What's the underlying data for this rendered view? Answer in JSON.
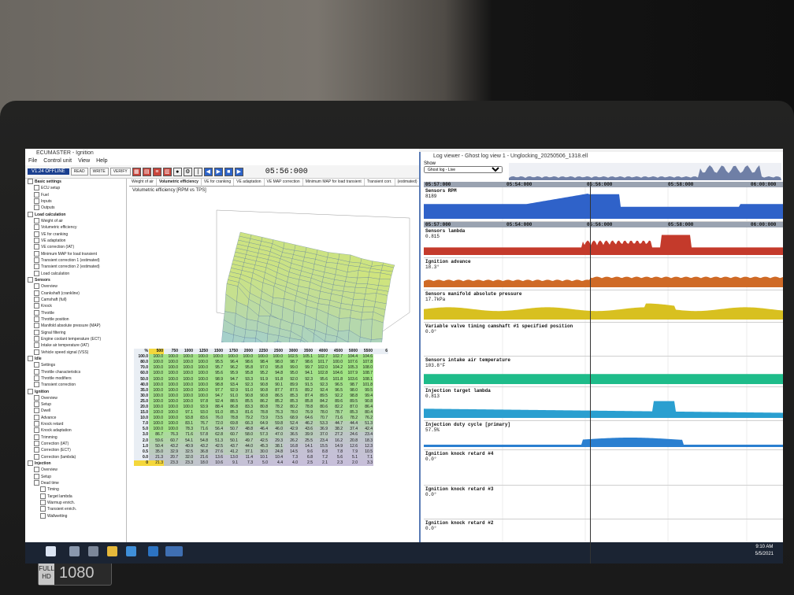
{
  "main_window": {
    "title": "ECUMASTER - Ignition",
    "menu": [
      "File",
      "Control unit",
      "View",
      "Help"
    ],
    "status": "V1.24 OFFLINE",
    "buttons": [
      "READ",
      "WRITE",
      "VERIFY"
    ],
    "time": "05:56:000"
  },
  "tree": [
    {
      "level": 0,
      "label": "Basic settings"
    },
    {
      "level": 1,
      "label": "ECU setup"
    },
    {
      "level": 1,
      "label": "Fuel"
    },
    {
      "level": 1,
      "label": "Inputs"
    },
    {
      "level": 1,
      "label": "Outputs"
    },
    {
      "level": 0,
      "label": "Load calculation"
    },
    {
      "level": 1,
      "label": "Weight of air"
    },
    {
      "level": 1,
      "label": "Volumetric efficiency"
    },
    {
      "level": 1,
      "label": "VE for cranking"
    },
    {
      "level": 1,
      "label": "VE adaptation"
    },
    {
      "level": 1,
      "label": "VE correction (IAT)"
    },
    {
      "level": 1,
      "label": "Minimum MAP for load transient"
    },
    {
      "level": 1,
      "label": "Transient correction 1 (estimated)"
    },
    {
      "level": 1,
      "label": "Transient correction 2 (estimated)"
    },
    {
      "level": 1,
      "label": "Load calculation"
    },
    {
      "level": 0,
      "label": "Sensors"
    },
    {
      "level": 1,
      "label": "Overview"
    },
    {
      "level": 1,
      "label": "Crankshaft (crankline)"
    },
    {
      "level": 1,
      "label": "Camshaft (full)"
    },
    {
      "level": 1,
      "label": "Knock"
    },
    {
      "level": 1,
      "label": "Throttle"
    },
    {
      "level": 1,
      "label": "Throttle position"
    },
    {
      "level": 1,
      "label": "Manifold absolute pressure (MAP)"
    },
    {
      "level": 1,
      "label": "Signal filtering"
    },
    {
      "level": 1,
      "label": "Engine coolant temperature (ECT)"
    },
    {
      "level": 1,
      "label": "Intake air temperature (IAT)"
    },
    {
      "level": 1,
      "label": "Vehicle speed signal (VSS)"
    },
    {
      "level": 0,
      "label": "Idle"
    },
    {
      "level": 1,
      "label": "Settings"
    },
    {
      "level": 1,
      "label": "Throttle characteristics"
    },
    {
      "level": 1,
      "label": "Throttle modifiers"
    },
    {
      "level": 1,
      "label": "Transient correction"
    },
    {
      "level": 0,
      "label": "Ignition"
    },
    {
      "level": 1,
      "label": "Overview"
    },
    {
      "level": 1,
      "label": "Setup"
    },
    {
      "level": 1,
      "label": "Dwell"
    },
    {
      "level": 1,
      "label": "Advance"
    },
    {
      "level": 1,
      "label": "Knock retard"
    },
    {
      "level": 1,
      "label": "Knock adaptation"
    },
    {
      "level": 1,
      "label": "Trimming"
    },
    {
      "level": 1,
      "label": "Correction (IAT)"
    },
    {
      "level": 1,
      "label": "Correction (ECT)"
    },
    {
      "level": 1,
      "label": "Correction (lambda)"
    },
    {
      "level": 0,
      "label": "Injection"
    },
    {
      "level": 1,
      "label": "Overview"
    },
    {
      "level": 1,
      "label": "Setup"
    },
    {
      "level": 1,
      "label": "Dead time"
    },
    {
      "level": 2,
      "label": "Timing"
    },
    {
      "level": 2,
      "label": "Target lambda"
    },
    {
      "level": 2,
      "label": "Warmup enrich."
    },
    {
      "level": 2,
      "label": "Transient enrich."
    },
    {
      "level": 2,
      "label": "Wallwetting"
    }
  ],
  "tabs": [
    "Weight of air",
    "Volumetric efficiency",
    "VE for cranking",
    "VE adaptation",
    "VE MAP correction",
    "Minimum MAP for load transient",
    "Transient corr.",
    "(estimated)"
  ],
  "table_title": "Volumetric efficiency [RPM vs TPS]",
  "grid": {
    "corner": "%",
    "rpm": [
      "500",
      "750",
      "1000",
      "1250",
      "1500",
      "1750",
      "2000",
      "2250",
      "2500",
      "3000",
      "3500",
      "4000",
      "4500",
      "5000",
      "5500",
      "6"
    ],
    "rows": [
      {
        "tps": "100.0",
        "v": [
          "100.0",
          "100.0",
          "100.0",
          "100.0",
          "100.0",
          "100.0",
          "100.0",
          "100.0",
          "100.0",
          "102.5",
          "105.1",
          "102.7",
          "102.7",
          "104.4",
          "104.6"
        ]
      },
      {
        "tps": "80.0",
        "v": [
          "100.0",
          "100.0",
          "100.0",
          "100.0",
          "95.5",
          "96.4",
          "98.6",
          "98.4",
          "98.0",
          "98.7",
          "98.6",
          "101.7",
          "100.0",
          "107.6",
          "107.8"
        ]
      },
      {
        "tps": "70.0",
        "v": [
          "100.0",
          "100.0",
          "100.0",
          "100.0",
          "95.7",
          "96.2",
          "95.8",
          "97.0",
          "95.8",
          "99.0",
          "99.7",
          "102.0",
          "104.2",
          "105.3",
          "108.0"
        ]
      },
      {
        "tps": "60.0",
        "v": [
          "100.0",
          "100.0",
          "100.0",
          "100.0",
          "95.6",
          "95.9",
          "95.8",
          "95.2",
          "94.8",
          "95.0",
          "94.1",
          "102.8",
          "104.6",
          "107.9",
          "108.7"
        ]
      },
      {
        "tps": "50.0",
        "v": [
          "100.0",
          "100.0",
          "100.0",
          "100.0",
          "98.9",
          "94.7",
          "93.3",
          "91.9",
          "91.8",
          "92.0",
          "92.3",
          "95.6",
          "101.8",
          "103.6",
          "108.1"
        ]
      },
      {
        "tps": "40.0",
        "v": [
          "100.0",
          "100.0",
          "100.0",
          "100.0",
          "98.8",
          "93.4",
          "92.3",
          "90.8",
          "90.1",
          "89.9",
          "91.5",
          "92.3",
          "96.5",
          "98.7",
          "101.8"
        ]
      },
      {
        "tps": "35.0",
        "v": [
          "100.0",
          "100.0",
          "100.0",
          "100.0",
          "97.7",
          "92.9",
          "91.0",
          "90.8",
          "87.7",
          "87.5",
          "89.2",
          "92.4",
          "96.5",
          "98.0",
          "99.5"
        ]
      },
      {
        "tps": "30.0",
        "v": [
          "100.0",
          "100.0",
          "100.0",
          "100.0",
          "94.7",
          "91.0",
          "90.8",
          "90.8",
          "86.5",
          "85.3",
          "87.4",
          "89.5",
          "92.2",
          "98.8",
          "99.4"
        ]
      },
      {
        "tps": "25.0",
        "v": [
          "100.0",
          "100.0",
          "100.0",
          "97.8",
          "92.4",
          "88.5",
          "85.5",
          "86.2",
          "85.2",
          "85.3",
          "85.8",
          "84.2",
          "89.6",
          "89.5",
          "90.8"
        ]
      },
      {
        "tps": "20.0",
        "v": [
          "100.0",
          "100.0",
          "100.0",
          "93.9",
          "88.4",
          "86.8",
          "83.3",
          "80.8",
          "78.2",
          "80.2",
          "78.8",
          "80.6",
          "82.2",
          "87.0",
          "86.4"
        ]
      },
      {
        "tps": "15.0",
        "v": [
          "100.0",
          "100.0",
          "97.1",
          "93.0",
          "91.0",
          "85.3",
          "81.6",
          "78.8",
          "76.3",
          "78.0",
          "76.9",
          "78.0",
          "78.7",
          "85.3",
          "80.4"
        ]
      },
      {
        "tps": "10.0",
        "v": [
          "100.0",
          "100.0",
          "93.8",
          "83.6",
          "76.0",
          "78.8",
          "79.2",
          "73.9",
          "73.5",
          "68.9",
          "64.6",
          "70.7",
          "71.6",
          "78.2",
          "76.2"
        ]
      },
      {
        "tps": "7.0",
        "v": [
          "100.0",
          "100.0",
          "83.1",
          "76.7",
          "72.0",
          "69.8",
          "66.3",
          "64.9",
          "59.8",
          "52.4",
          "46.2",
          "53.3",
          "44.7",
          "44.4",
          "51.3"
        ]
      },
      {
        "tps": "5.0",
        "v": [
          "100.0",
          "100.0",
          "78.3",
          "71.6",
          "56.4",
          "50.7",
          "48.8",
          "46.4",
          "46.0",
          "42.9",
          "43.6",
          "36.9",
          "38.2",
          "37.4",
          "42.4"
        ]
      },
      {
        "tps": "3.0",
        "v": [
          "86.7",
          "76.3",
          "71.6",
          "57.8",
          "62.8",
          "60.7",
          "58.0",
          "57.3",
          "47.0",
          "36.5",
          "39.9",
          "37.0",
          "27.2",
          "24.6",
          "23.4"
        ]
      },
      {
        "tps": "2.0",
        "v": [
          "59.6",
          "60.7",
          "54.1",
          "54.8",
          "51.3",
          "50.1",
          "49.7",
          "42.5",
          "29.3",
          "26.2",
          "25.5",
          "23.4",
          "16.2",
          "20.8",
          "18.3"
        ]
      },
      {
        "tps": "1.0",
        "v": [
          "50.4",
          "43.2",
          "40.9",
          "43.2",
          "42.5",
          "43.7",
          "44.0",
          "45.3",
          "38.1",
          "16.8",
          "14.1",
          "15.5",
          "14.9",
          "12.6",
          "12.3"
        ]
      },
      {
        "tps": "0.5",
        "v": [
          "35.0",
          "32.9",
          "32.5",
          "36.8",
          "27.6",
          "41.2",
          "37.1",
          "30.0",
          "24.8",
          "14.5",
          "9.6",
          "8.8",
          "7.8",
          "7.9",
          "10.5"
        ]
      },
      {
        "tps": "0.0",
        "v": [
          "21.3",
          "20.7",
          "32.0",
          "21.6",
          "13.6",
          "13.0",
          "11.4",
          "10.1",
          "10.4",
          "7.3",
          "6.8",
          "7.2",
          "5.6",
          "5.1",
          "7.1"
        ]
      },
      {
        "tps": "0",
        "v": [
          "21.3",
          "23.3",
          "23.3",
          "18.0",
          "10.6",
          "9.1",
          "7.3",
          "5.0",
          "4.4",
          "4.0",
          "2.5",
          "2.1",
          "2.3",
          "2.0",
          "3.3"
        ]
      }
    ]
  },
  "log": {
    "title": "Log viewer - Ghost log view 1 - Unglocking_20250506_1318.ell",
    "show_label": "Show",
    "show_value": "Ghost log - Live",
    "time_marks": [
      "05:54:000",
      "05:56:000",
      "05:58:000",
      "06:00:000"
    ],
    "cursor_time": "05:57:000",
    "tracks": [
      {
        "name": "Sensors RPM",
        "value": "8189",
        "color": "#2f62c9",
        "header": true
      },
      {
        "name": "Sensors lambda",
        "value": "0.815",
        "color": "#c43a2b",
        "header": true
      },
      {
        "name": "Ignition advance",
        "value": "18.3°",
        "color": "#cf6a26"
      },
      {
        "name": "Sensors manifold absolute pressure",
        "value": "17.7kPa",
        "color": "#d8c020"
      },
      {
        "name": "Variable valve timing camshaft #1 specified position",
        "value": "0.0°",
        "color": "#7a9a2a"
      },
      {
        "name": "Sensors intake air temperature",
        "value": "103.8°F",
        "color": "#1ebc8a"
      },
      {
        "name": "Injection target lambda",
        "value": "0.813",
        "color": "#2a9fd0"
      },
      {
        "name": "Injection duty cycle [primary]",
        "value": "57.5%",
        "color": "#2a7fd0"
      },
      {
        "name": "Ignition knock retard #4",
        "value": "0.0°",
        "color": "#888888"
      },
      {
        "name": "Ignition knock retard #3",
        "value": "0.0°",
        "color": "#888888"
      },
      {
        "name": "Ignition knock retard #2",
        "value": "0.0°",
        "color": "#888888"
      }
    ]
  },
  "taskbar": {
    "time": "9:10 AM",
    "date": "5/5/2021"
  },
  "bezel": {
    "badge_top": "FULL HD",
    "badge_res": "1080"
  }
}
